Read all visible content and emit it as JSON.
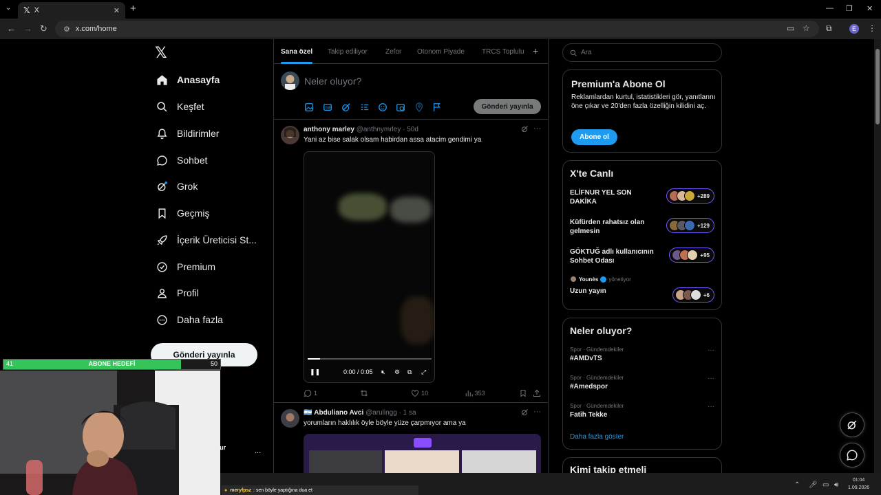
{
  "browser": {
    "tab_title": "X",
    "url": "x.com/home",
    "new_tab": "+",
    "profile_initial": "E"
  },
  "nav": {
    "logo": "𝕏",
    "items": [
      {
        "label": "Anasayfa",
        "icon": "home-icon"
      },
      {
        "label": "Keşfet",
        "icon": "search-icon"
      },
      {
        "label": "Bildirimler",
        "icon": "bell-icon"
      },
      {
        "label": "Sohbet",
        "icon": "chat-icon"
      },
      {
        "label": "Grok",
        "icon": "grok-icon"
      },
      {
        "label": "Geçmiş",
        "icon": "bookmark-icon"
      },
      {
        "label": "İçerik Üreticisi St...",
        "icon": "rocket-icon"
      },
      {
        "label": "Premium",
        "icon": "premium-icon"
      },
      {
        "label": "Profil",
        "icon": "profile-icon"
      },
      {
        "label": "Daha fazla",
        "icon": "more-icon"
      }
    ],
    "post_button": "Gönderi yayınla"
  },
  "timeline": {
    "tabs": [
      "Sana özel",
      "Takip ediliyor",
      "Zefor",
      "Otonom Piyade",
      "TRCS Toplulu"
    ],
    "compose": {
      "placeholder": "Neler oluyor?",
      "post_button": "Gönderi yayınla"
    },
    "tweets": [
      {
        "name": "anthony marley",
        "handle": "@anthnymrley",
        "time": "· 50d",
        "text": "Yani az bise salak olsam habirdan assa atacim gendimi ya",
        "video_time": "0:00 / 0:05",
        "video_progress": 0.1,
        "replies": "1",
        "likes": "10",
        "views": "353"
      },
      {
        "flag": "🇦🇷",
        "name": "Abduliano Avci",
        "handle": "@arulingg",
        "time": "· 1 sa",
        "text": "yorumların haklılık öyle böyle yüze çarpmıyor ama ya"
      }
    ]
  },
  "right": {
    "search_placeholder": "Ara",
    "premium": {
      "title": "Premium'a Abone Ol",
      "description": "Reklamlardan kurtul, istatistikleri gör, yanıtlarını öne çıkar ve 20'den fazla özelliğin kilidini aç.",
      "button": "Abone ol"
    },
    "live": {
      "title": "X'te Canlı",
      "items": [
        {
          "title": "ELİFNUR YEL SON DAKİKA",
          "count": "+289"
        },
        {
          "title": "Küfürden rahatsız olan gelmesin",
          "count": "+129"
        },
        {
          "title": "GÖKTUĞ adlı kullanıcının Sohbet Odası",
          "count": "+95"
        },
        {
          "host": "Younès",
          "host_role": "yönetiyor",
          "title": "Uzun yayın",
          "count": "+6"
        }
      ]
    },
    "trends": {
      "title": "Neler oluyor?",
      "items": [
        {
          "category": "Spor · Gündemdekiler",
          "name": "#AMDvTS"
        },
        {
          "category": "Spor · Gündemdekiler",
          "name": "#Amedspor"
        },
        {
          "category": "Spor · Gündemdekiler",
          "name": "Fatih Tekke"
        }
      ],
      "show_more": "Daha fazla göster"
    },
    "who_to_follow": "Kimi takip etmeli"
  },
  "overlay": {
    "goal_label": "ABONE HEDEFİ",
    "goal_current": "41",
    "goal_target": "50",
    "goal_fraction": 0.82,
    "partial_text": "ur",
    "dots": "..."
  },
  "taskbar": {
    "chat_user": "meryfpsz",
    "chat_text": ": sen böyle yaptığına dua et",
    "time": "01:04",
    "date": "1.09.2026"
  },
  "colors": {
    "accent": "#1d9bf0",
    "live_border": "#7856ff",
    "goal_fill": "#35c45a"
  }
}
